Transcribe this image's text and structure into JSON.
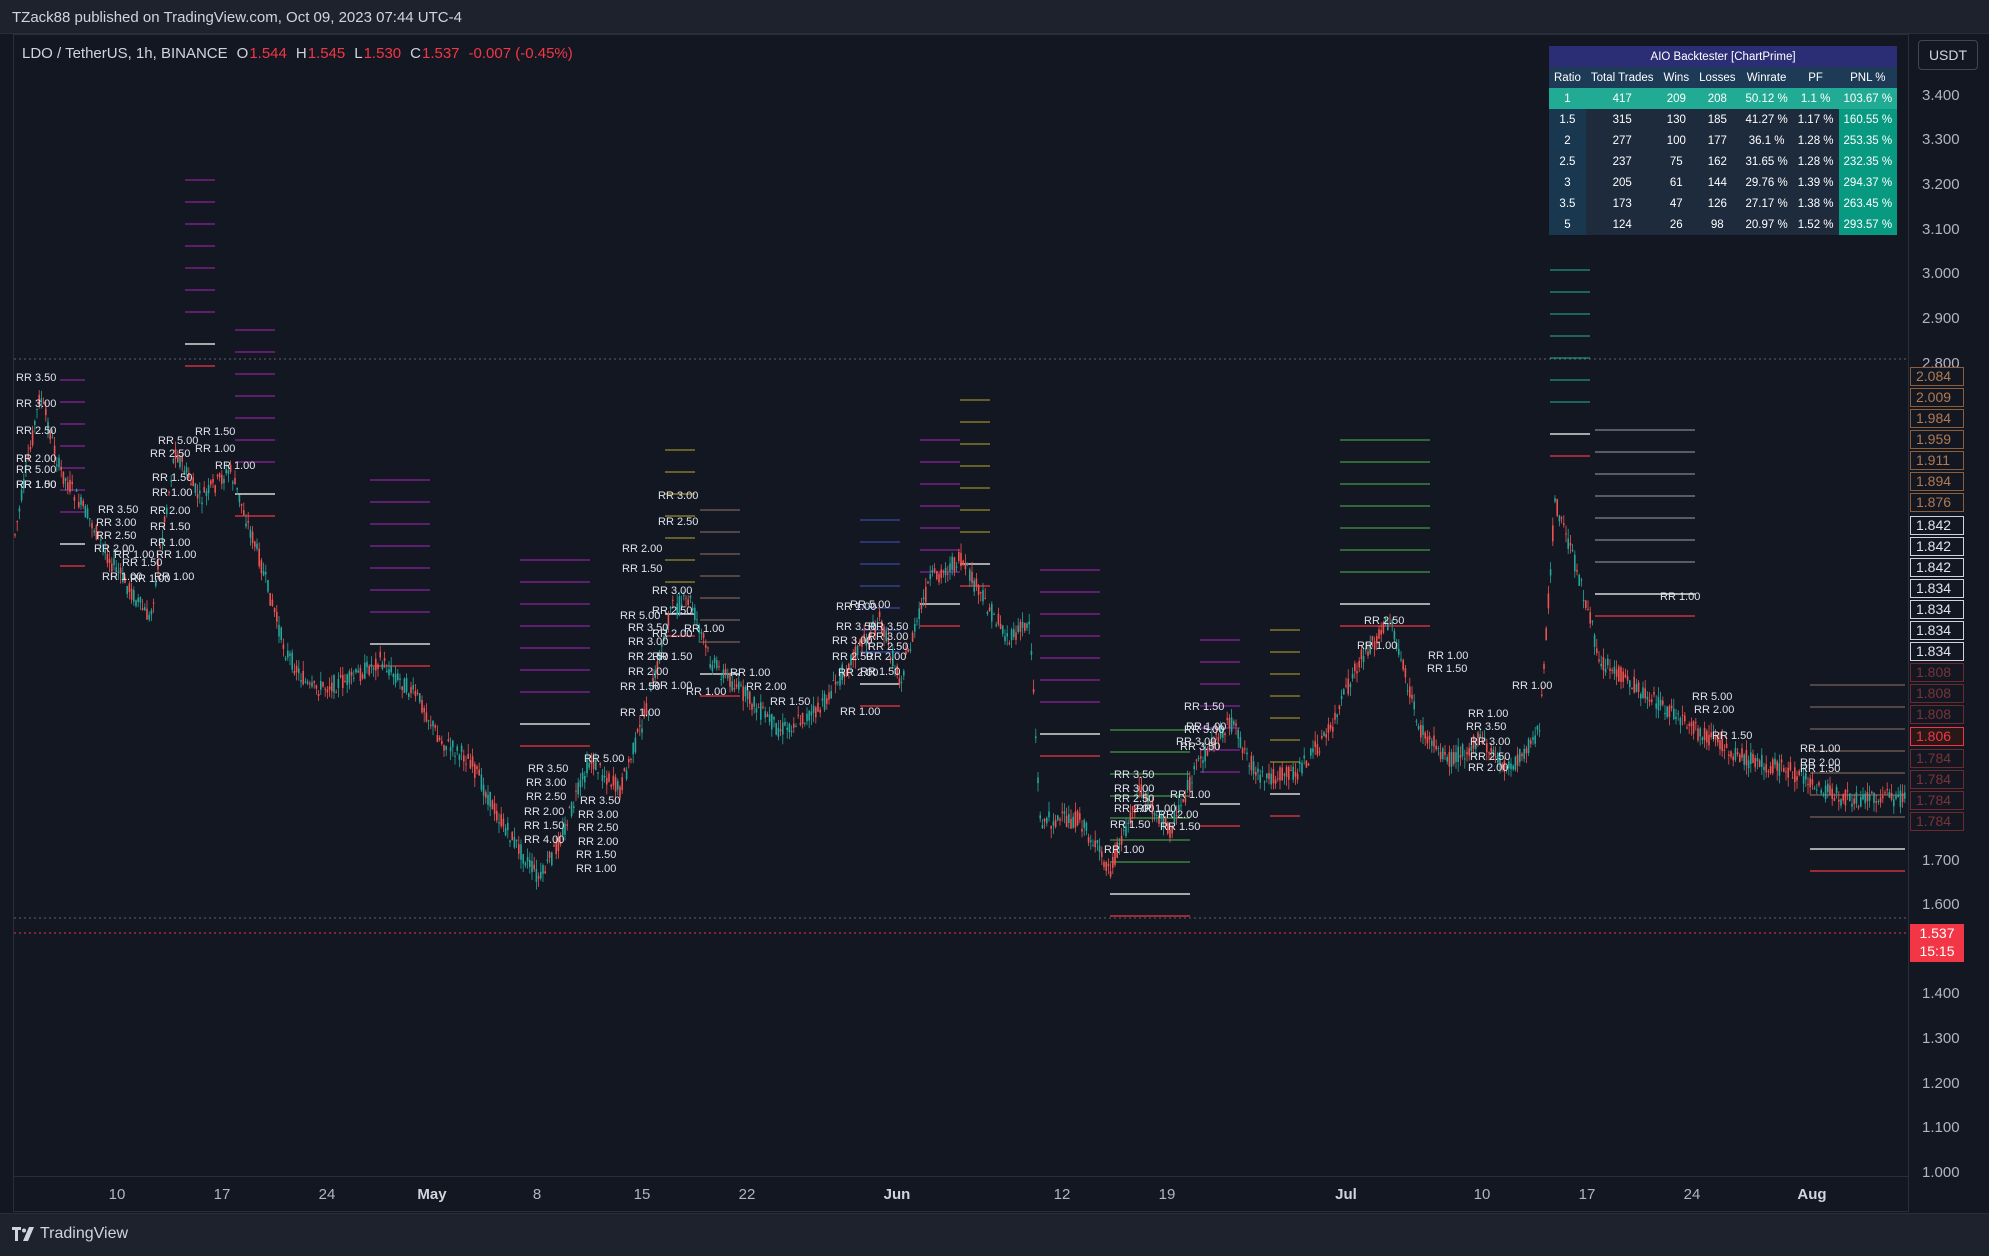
{
  "header": {
    "published": "TZack88 published on TradingView.com, Oct 09, 2023 07:44 UTC-4"
  },
  "footer": {
    "brand": "TradingView"
  },
  "legend": {
    "symbol": "LDO / TetherUS, 1h, BINANCE",
    "open_label": "O",
    "open": "1.544",
    "high_label": "H",
    "high": "1.545",
    "low_label": "L",
    "low": "1.530",
    "close_label": "C",
    "close": "1.537",
    "change": "-0.007 (-0.45%)"
  },
  "currency": "USDT",
  "y_ticks": [
    "3.400",
    "3.300",
    "3.200",
    "3.100",
    "3.000",
    "2.900",
    "2.800",
    "1.700",
    "1.600",
    "1.400",
    "1.300",
    "1.200",
    "1.100",
    "1.000"
  ],
  "x_ticks": [
    {
      "label": "10",
      "bold": false
    },
    {
      "label": "17",
      "bold": false
    },
    {
      "label": "24",
      "bold": false
    },
    {
      "label": "May",
      "bold": true
    },
    {
      "label": "8",
      "bold": false
    },
    {
      "label": "15",
      "bold": false
    },
    {
      "label": "22",
      "bold": false
    },
    {
      "label": "Jun",
      "bold": true
    },
    {
      "label": "12",
      "bold": false
    },
    {
      "label": "19",
      "bold": false
    },
    {
      "label": "Jul",
      "bold": true
    },
    {
      "label": "10",
      "bold": false
    },
    {
      "label": "17",
      "bold": false
    },
    {
      "label": "24",
      "bold": false
    },
    {
      "label": "Aug",
      "bold": true
    }
  ],
  "price_labels": [
    {
      "value": "2.084",
      "style": "brown"
    },
    {
      "value": "2.009",
      "style": "brown"
    },
    {
      "value": "1.984",
      "style": "brown"
    },
    {
      "value": "1.959",
      "style": "brown"
    },
    {
      "value": "1.911",
      "style": "brown"
    },
    {
      "value": "1.894",
      "style": "brown"
    },
    {
      "value": "1.876",
      "style": "brown"
    },
    {
      "value": "1.842",
      "style": "white"
    },
    {
      "value": "1.842",
      "style": "white"
    },
    {
      "value": "1.842",
      "style": "white"
    },
    {
      "value": "1.834",
      "style": "white"
    },
    {
      "value": "1.834",
      "style": "white"
    },
    {
      "value": "1.834",
      "style": "white"
    },
    {
      "value": "1.834",
      "style": "white"
    },
    {
      "value": "1.808",
      "style": "redfaded"
    },
    {
      "value": "1.808",
      "style": "redfaded"
    },
    {
      "value": "1.808",
      "style": "redfaded"
    },
    {
      "value": "1.806",
      "style": "red"
    },
    {
      "value": "1.784",
      "style": "redfaded"
    },
    {
      "value": "1.784",
      "style": "redfaded"
    },
    {
      "value": "1.784",
      "style": "redfaded"
    },
    {
      "value": "1.784",
      "style": "redfaded"
    }
  ],
  "current_price": {
    "price": "1.537",
    "countdown": "15:15"
  },
  "backtester": {
    "title": "AIO Backtester  [ChartPrime]",
    "headers": [
      "Ratio",
      "Total Trades",
      "Wins",
      "Losses",
      "Winrate",
      "PF",
      "PNL %"
    ],
    "rows": [
      [
        "1",
        "417",
        "209",
        "208",
        "50.12 %",
        "1.1 %",
        "103.67 %"
      ],
      [
        "1.5",
        "315",
        "130",
        "185",
        "41.27 %",
        "1.17 %",
        "160.55 %"
      ],
      [
        "2",
        "277",
        "100",
        "177",
        "36.1 %",
        "1.28 %",
        "253.35 %"
      ],
      [
        "2.5",
        "237",
        "75",
        "162",
        "31.65 %",
        "1.28 %",
        "232.35 %"
      ],
      [
        "3",
        "205",
        "61",
        "144",
        "29.76 %",
        "1.39 %",
        "294.37 %"
      ],
      [
        "3.5",
        "173",
        "47",
        "126",
        "27.17 %",
        "1.38 %",
        "263.45 %"
      ],
      [
        "5",
        "124",
        "26",
        "98",
        "20.97 %",
        "1.52 %",
        "293.57 %"
      ]
    ]
  },
  "rr_labels": [
    "RR 3.50",
    "RR 3.00",
    "RR 2.50",
    "RR 2.00",
    "RR 5.00",
    "RR 1.50",
    "RR 1.00",
    "RR 5.00",
    "RR 2.50",
    "RR 1.50",
    "RR 1.00",
    "RR 1.50",
    "RR 1.00",
    "RR 1.00",
    "RR 3.50",
    "RR 3.00",
    "RR 2.50",
    "RR 2.00",
    "RR 1.50",
    "RR 1.00",
    "RR 2.00",
    "RR 1.50",
    "RR 1.00",
    "RR 1.00",
    "RR 1.00",
    "RR 1.00",
    "RR 1.00",
    "RR 3.50",
    "RR 3.00",
    "RR 2.50",
    "RR 2.00",
    "RR 1.50",
    "RR 4.00",
    "RR 3.50",
    "RR 3.00",
    "RR 2.50",
    "RR 2.00",
    "RR 1.50",
    "RR 1.00",
    "RR 5.00",
    "RR 3.00",
    "RR 2.50",
    "RR 2.00",
    "RR 1.50",
    "RR 5.00",
    "RR 3.50",
    "RR 3.00",
    "RR 2.50",
    "RR 2.00",
    "RR 1.50",
    "RR 1.00",
    "RR 1.00",
    "RR 1.00",
    "RR 2.00",
    "RR 1.50",
    "RR 1.00",
    "RR 1.00",
    "RR 3.50",
    "RR 3.00",
    "RR 2.50",
    "RR 2.00",
    "RR 1.00",
    "RR 5.00",
    "RR 3.50",
    "RR 3.00",
    "RR 2.50",
    "RR 2.00",
    "RR 1.50",
    "RR 3.00",
    "RR 2.50",
    "RR 2.00",
    "RR 1.50",
    "RR 1.00",
    "RR 3.50",
    "RR 3.00",
    "RR 2.50",
    "RR 2.00",
    "RR 1.50",
    "RR 1.00",
    "RR 2.00",
    "RR 1.50",
    "RR 1.00",
    "RR 1.00",
    "RR 1.50",
    "RR 1.00",
    "RR 5.00",
    "RR 3.50",
    "RR 3.00",
    "RR 2.50",
    "RR 1.00",
    "RR 1.00",
    "RR 1.50",
    "RR 1.00",
    "RR 3.50",
    "RR 3.00",
    "RR 2.50",
    "RR 2.00",
    "RR 1.00",
    "RR 5.00",
    "RR 2.00",
    "RR 1.50",
    "RR 1.00",
    "RR 2.00",
    "RR 1.50",
    "RR 1.00"
  ]
}
